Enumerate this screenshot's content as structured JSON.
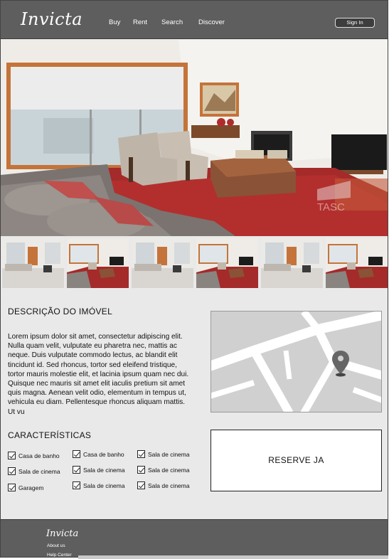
{
  "header": {
    "logo": "Invicta",
    "nav": [
      "Buy",
      "Rent",
      "Search",
      "Discover"
    ],
    "signin": "Sign In"
  },
  "hero": {
    "watermark": "TASC",
    "alt": "Living room photo"
  },
  "thumbnails": [
    {
      "style": "white"
    },
    {
      "style": "red"
    },
    {
      "style": "white"
    },
    {
      "style": "red"
    },
    {
      "style": "white"
    },
    {
      "style": "red"
    }
  ],
  "description": {
    "title": "DESCRIÇÃO DO IMÓVEL",
    "text": "Lorem ipsum dolor sit amet, consectetur adipiscing elit. Nulla quam velit, vulputate eu pharetra nec, mattis ac neque. Duis vulputate commodo lectus, ac blandit elit tincidunt id. Sed rhoncus, tortor sed eleifend tristique, tortor mauris molestie elit, et lacinia ipsum quam nec dui. Quisque nec mauris sit amet elit iaculis pretium sit amet quis magna. Aenean velit odio, elementum in tempus ut, vehicula eu diam. Pellentesque rhoncus aliquam mattis. Ut vu"
  },
  "characteristics": {
    "title": "CARACTERÍSTICAS",
    "items": [
      {
        "label": "Casa de banho",
        "checked": true
      },
      {
        "label": "Casa de banho",
        "checked": true
      },
      {
        "label": "Sala de cinema",
        "checked": true
      },
      {
        "label": "Sala de cinema",
        "checked": true
      },
      {
        "label": "Sala de cinema",
        "checked": true
      },
      {
        "label": "Sala de cinema",
        "checked": true
      },
      {
        "label": "Garagem",
        "checked": true
      },
      {
        "label": "Sala de cinema",
        "checked": true
      },
      {
        "label": "Sala de cinema",
        "checked": true
      }
    ]
  },
  "reserve": {
    "label": "RESERVE JA"
  },
  "footer": {
    "logo": "Invicta",
    "links": [
      "About us",
      "Help Center"
    ]
  }
}
